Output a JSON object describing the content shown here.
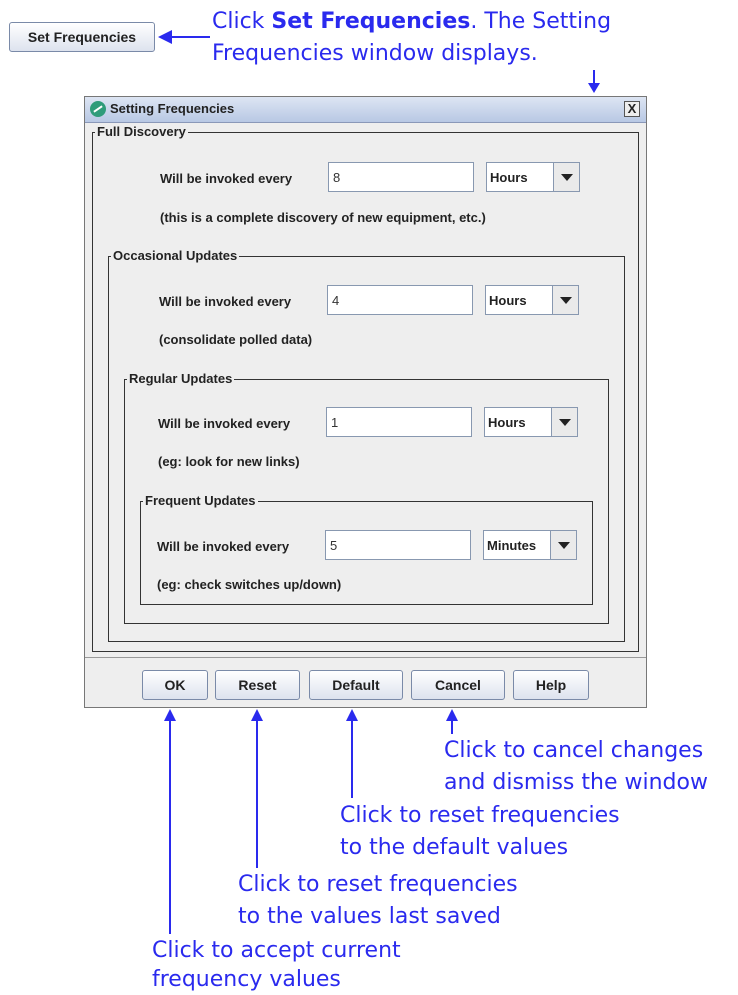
{
  "top_button": {
    "label": "Set Frequencies"
  },
  "top_annotation": {
    "part1": "Click ",
    "bold": "Set Frequencies",
    "part2": ". The Setting",
    "line2": "Frequencies window displays."
  },
  "window": {
    "title": "Setting Frequencies",
    "close_label": "X",
    "sections": [
      {
        "title": "Full Discovery",
        "label": "Will be invoked every",
        "value": "8",
        "unit": "Hours",
        "note": "(this is a complete discovery of new equipment, etc.)"
      },
      {
        "title": "Occasional Updates",
        "label": "Will be invoked every",
        "value": "4",
        "unit": "Hours",
        "note": "(consolidate polled data)"
      },
      {
        "title": "Regular Updates",
        "label": "Will be invoked every",
        "value": "1",
        "unit": "Hours",
        "note": "(eg: look for new links)"
      },
      {
        "title": "Frequent Updates",
        "label": "Will be invoked every",
        "value": "5",
        "unit": "Minutes",
        "note": "(eg: check switches up/down)"
      }
    ],
    "buttons": {
      "ok": "OK",
      "reset": "Reset",
      "default": "Default",
      "cancel": "Cancel",
      "help": "Help"
    }
  },
  "annotations": {
    "cancel": [
      "Click to cancel  changes",
      "and dismiss the window"
    ],
    "default": [
      "Click to reset frequencies",
      "to the default values"
    ],
    "reset": [
      "Click to reset frequencies",
      "to the values last saved"
    ],
    "ok": [
      "Click to accept current",
      "frequency values"
    ]
  },
  "colors": {
    "annotation": "#2a2aee",
    "window_bg": "#eeeeee"
  }
}
